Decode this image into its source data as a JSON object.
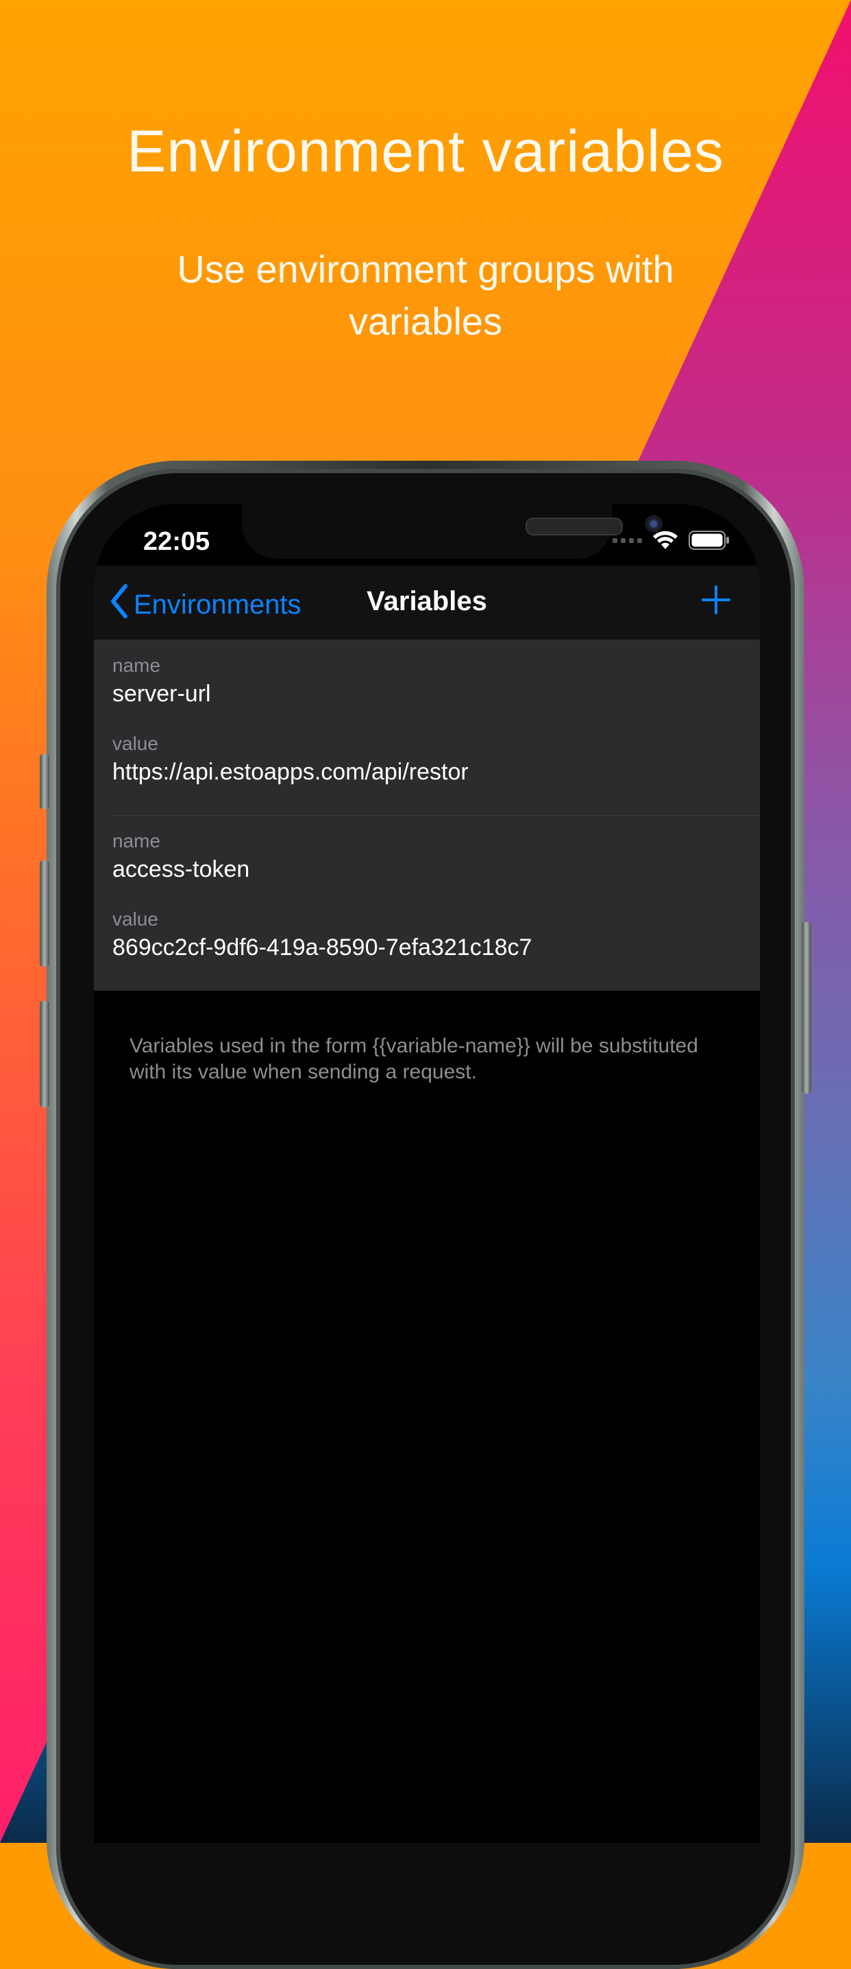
{
  "marketing": {
    "headline": "Environment variables",
    "subline": "Use environment groups with variables"
  },
  "status_bar": {
    "time": "22:05"
  },
  "navbar": {
    "back_label": "Environments",
    "title": "Variables",
    "back_icon": "chevron-left-icon",
    "add_icon": "plus-icon"
  },
  "variables": [
    {
      "name_label": "name",
      "name": "server-url",
      "value_label": "value",
      "value": "https://api.estoapps.com/api/restor"
    },
    {
      "name_label": "name",
      "name": "access-token",
      "value_label": "value",
      "value": "869cc2cf-9df6-419a-8590-7efa321c18c7"
    }
  ],
  "footer_note": "Variables used in the form {{variable-name}} will be substituted with its value when sending a request.",
  "colors": {
    "accent": "#0a84ff",
    "background_top": "#ffa300",
    "background_pink": "#f3106e",
    "screen": "#000000",
    "cell": "#2c2c2e"
  }
}
